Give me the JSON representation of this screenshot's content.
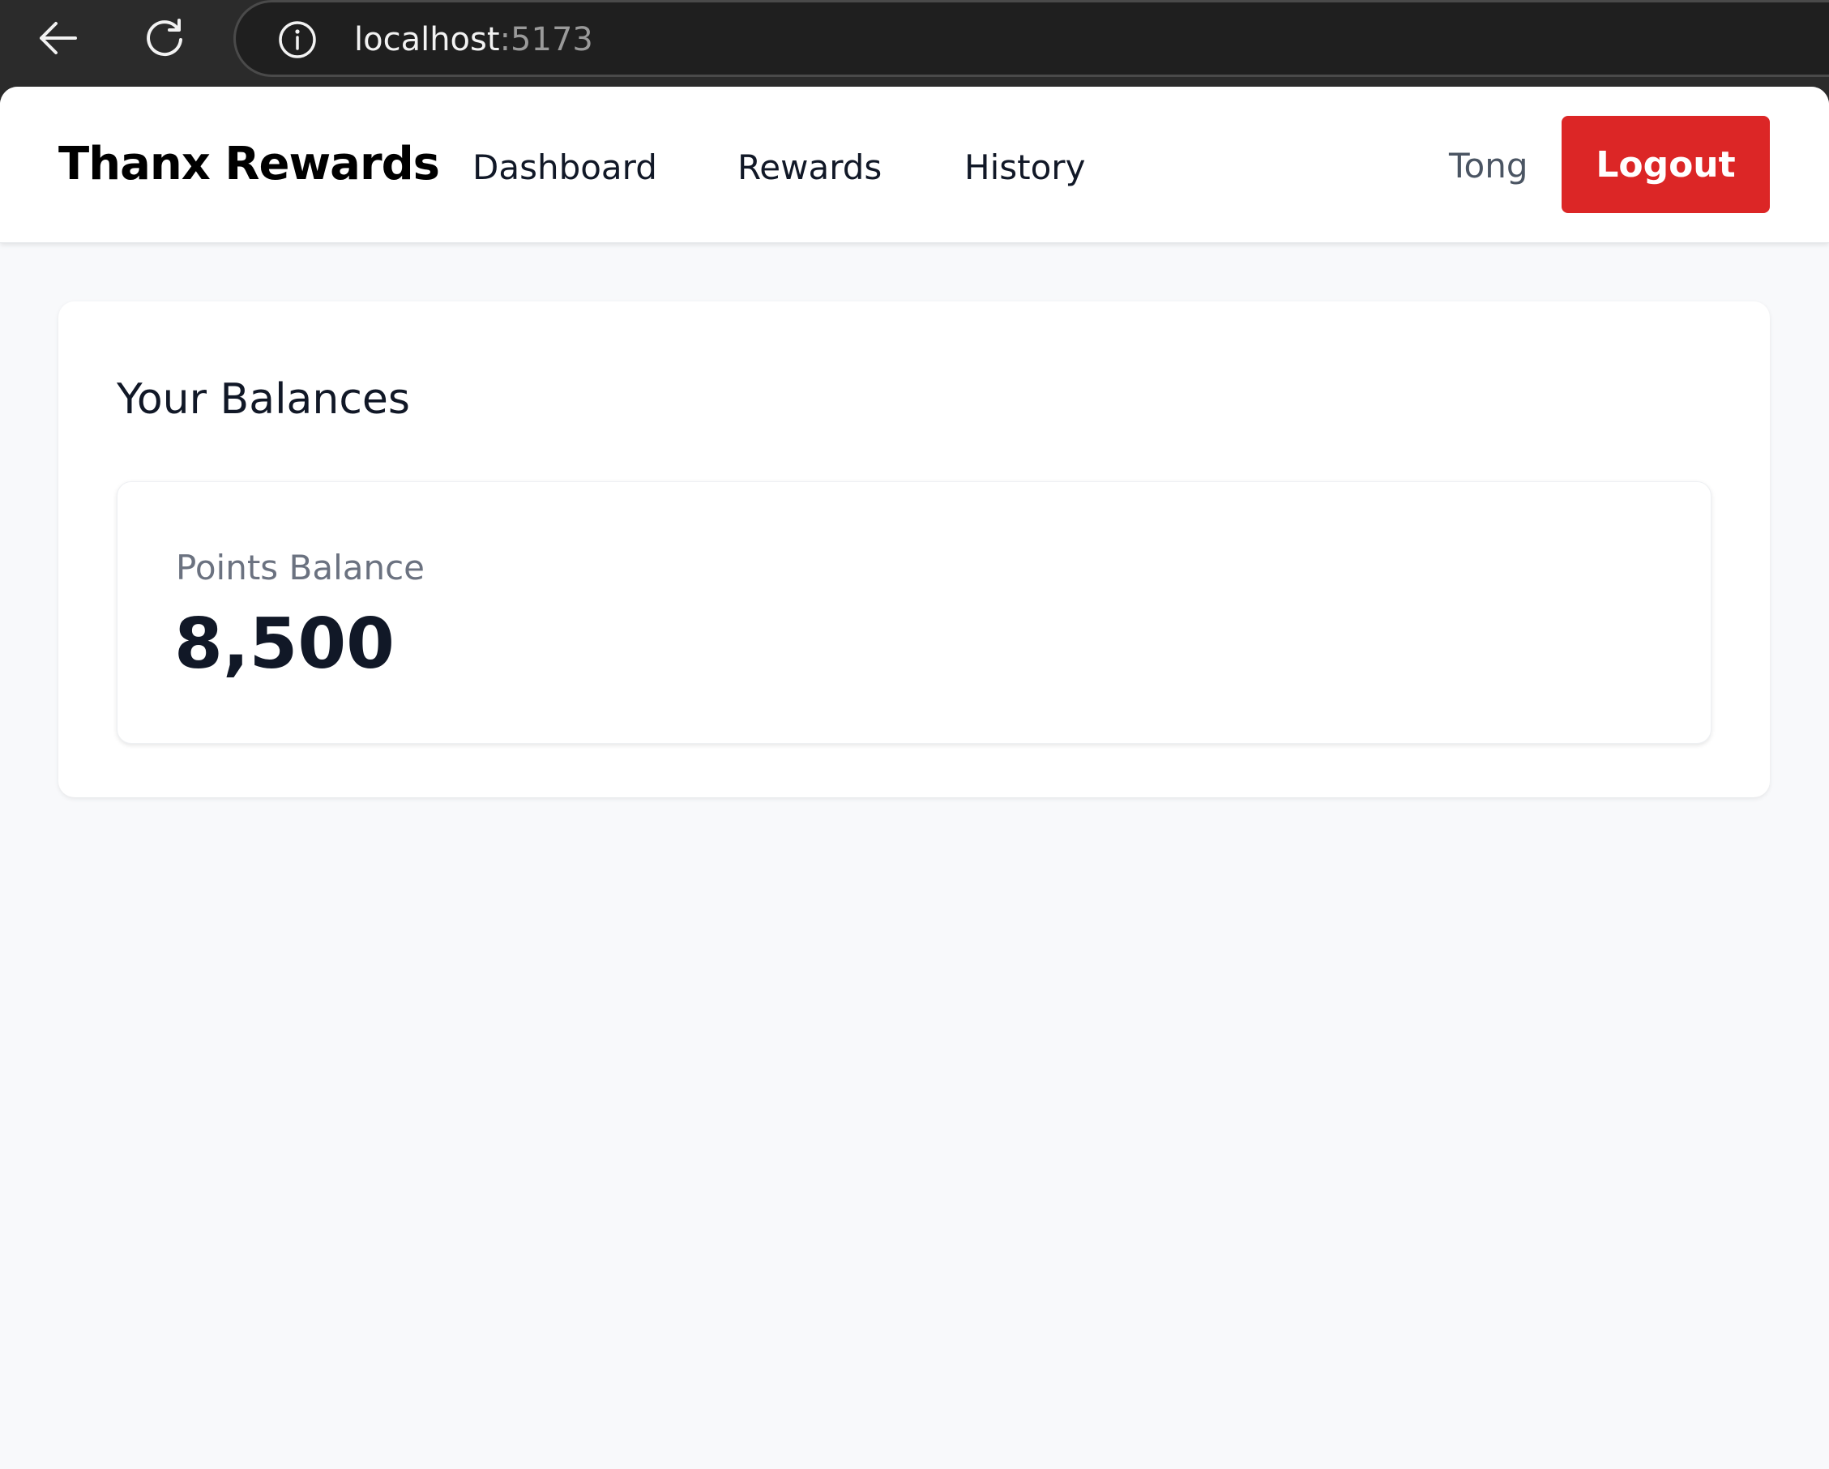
{
  "browser": {
    "url_host": "localhost",
    "url_port": ":5173",
    "icons": {
      "back": "back-arrow-icon",
      "reload": "reload-icon",
      "info": "info-icon"
    }
  },
  "navbar": {
    "brand": "Thanx Rewards",
    "links": [
      "Dashboard",
      "Rewards",
      "History"
    ],
    "username": "Tong",
    "logout_label": "Logout",
    "logout_color": "#dc2626"
  },
  "main": {
    "section_title": "Your Balances",
    "points": {
      "label": "Points Balance",
      "value": "8,500"
    }
  },
  "colors": {
    "page_background": "#f8f9fb",
    "card_background": "#ffffff",
    "chrome_background": "#2b2b2b"
  }
}
